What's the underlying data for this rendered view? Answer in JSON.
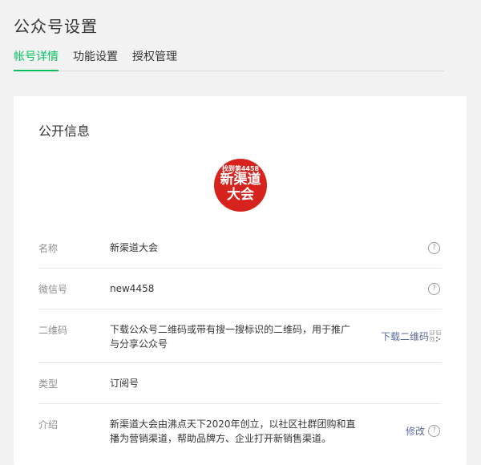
{
  "header": {
    "title": "公众号设置"
  },
  "tabs": [
    {
      "label": "帐号详情",
      "active": true
    },
    {
      "label": "功能设置",
      "active": false
    },
    {
      "label": "授权管理",
      "active": false
    }
  ],
  "section": {
    "title": "公开信息"
  },
  "logo": {
    "small_text": "找到第4458",
    "line1": "新渠道",
    "line2": "大会",
    "color": "#d7231d"
  },
  "rows": {
    "name": {
      "label": "名称",
      "value": "新渠道大会"
    },
    "wechat_id": {
      "label": "微信号",
      "value": "new4458"
    },
    "qrcode": {
      "label": "二维码",
      "value": "下载公众号二维码或带有搜一搜标识的二维码，用于推广与分享公众号",
      "action": "下载二维码"
    },
    "type": {
      "label": "类型",
      "value": "订阅号"
    },
    "intro": {
      "label": "介绍",
      "value": "新渠道大会由沸点天下2020年创立，以社区社群团购和直播为营销渠道，帮助品牌方、企业打开新销售渠道。",
      "action": "修改"
    }
  },
  "colors": {
    "accent": "#07c160",
    "link": "#576b95"
  },
  "icons": {
    "help": "question-circle-icon",
    "qr": "qrcode-icon"
  }
}
